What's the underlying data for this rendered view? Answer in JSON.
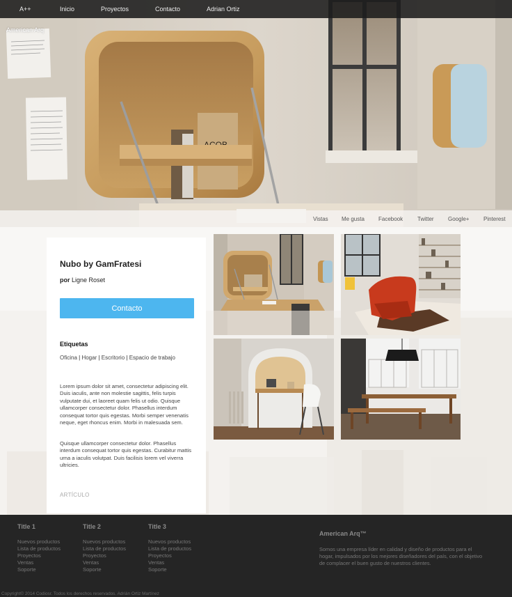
{
  "nav": {
    "brand": "A++",
    "items": [
      "Inicio",
      "Proyectos",
      "Contacto",
      "Adrian Ortiz"
    ],
    "subtitle": "American Arq"
  },
  "share": {
    "items": [
      "Vistas",
      "Me gusta",
      "Facebook",
      "Twitter",
      "Google+",
      "Pinterest"
    ]
  },
  "product": {
    "title": "Nubo by GamFratesi",
    "maker_prefix": "por",
    "maker_name": "Ligne Roset",
    "contact_label": "Contacto",
    "tags_title": "Etiquetas",
    "tags": [
      "Oficina",
      "Hogar",
      "Escritorio",
      "Espacio de trabajo"
    ],
    "tag_separator": "|",
    "paragraph1": "Lorem ipsum dolor sit amet, consectetur adipiscing elit. Duis iaculis, ante non molestie sagittis, felis turpis vulputate dui, et laoreet quam felis ut odio. Quisque ullamcorper consectetur dolor. Phasellus interdum consequat tortor quis egestas. Morbi semper venenatis neque, eget rhoncus enim. Morbi in malesuada sem.",
    "paragraph2": "Quisque ullamcorper consectetur dolor. Phasellus interdum consequat tortor quis egestas. Curabitur mattis urna a iaculis volutpat. Duis facilisis lorem vel viverra ultricies.",
    "article_label": "ARTÍCULO"
  },
  "gallery": {
    "photos": [
      "wall-desk-photo",
      "red-armchair-photo",
      "hooded-desk-photo",
      "dining-table-photo"
    ]
  },
  "footer": {
    "columns": [
      {
        "title": "Title 1",
        "links": [
          "Nuevos productos",
          "Lista de productos",
          "Proyectos",
          "Ventas",
          "Soporte"
        ]
      },
      {
        "title": "Title 2",
        "links": [
          "Nuevos productos",
          "Lista de productos",
          "Proyectos",
          "Ventas",
          "Soporte"
        ]
      },
      {
        "title": "Title 3",
        "links": [
          "Nuevos productos",
          "Lista de productos",
          "Proyectos",
          "Ventas",
          "Soporte"
        ]
      }
    ],
    "about_title": "American Arq™",
    "about_text": "Somos una empresa líder en calidad y diseño de productos para el hogar, impulsados por los mejores diseñadores del país, con el objetivo de complacer el buen gusto de nuestros clientes.",
    "copyright": "Copyright© 2014 Codiosr. Todos los derechos reservados. Adrián Ortiz Martínez"
  },
  "colors": {
    "accent": "#4db6ef",
    "nav_bg": "#1c1c1c",
    "footer_bg": "#252525"
  }
}
